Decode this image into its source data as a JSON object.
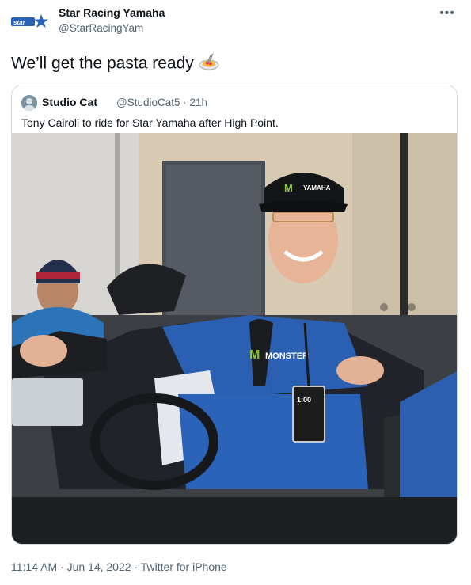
{
  "tweet": {
    "author_name": "Star Racing Yamaha",
    "author_handle": "@StarRacingYam",
    "more_label": "•••",
    "text": "We’ll get the pasta ready",
    "emoji_icon": "spaghetti-emoji-icon"
  },
  "quoted": {
    "author_name": "Studio Cat",
    "author_handle": "@StudioCat5 · 21h",
    "text": "Tony Cairoli to ride for Star Yamaha after High Point.",
    "photo_hat_text": "YAMAHA",
    "photo_pass_text": "1:00"
  },
  "footer": {
    "time": "11:14 AM",
    "separator": " · ",
    "date": "Jun 14, 2022",
    "source": "Twitter for iPhone"
  },
  "colors": {
    "text": "#0f1419",
    "secondary": "#536471",
    "border": "#cfd9de",
    "brand_blue": "#2a63b5"
  }
}
